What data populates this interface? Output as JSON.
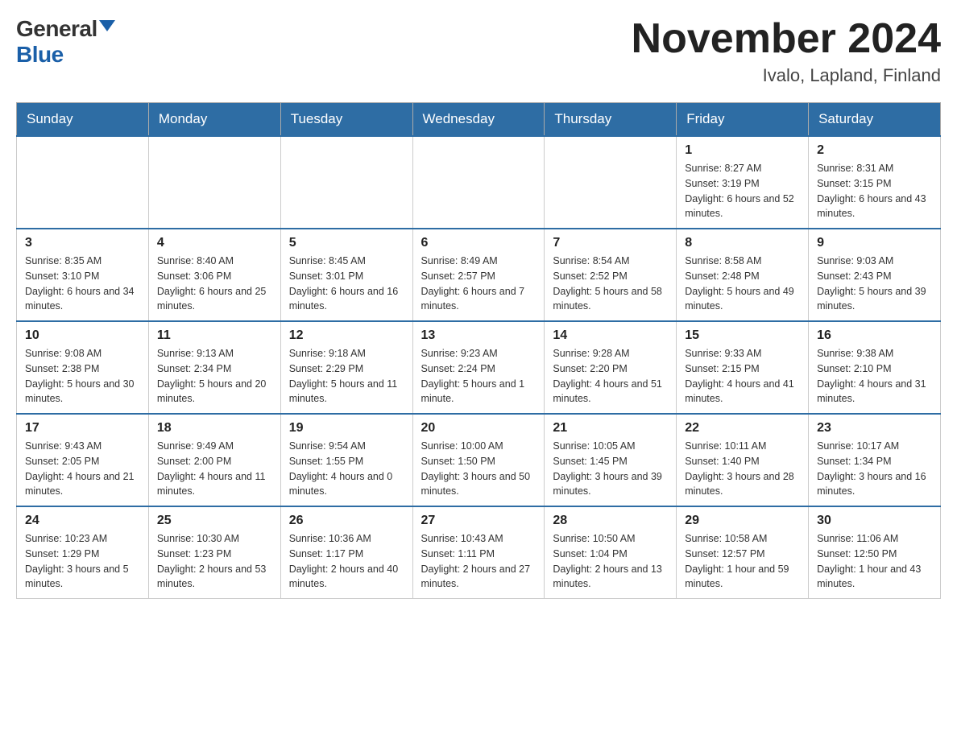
{
  "header": {
    "logo_general": "General",
    "logo_blue": "Blue",
    "month_year": "November 2024",
    "location": "Ivalo, Lapland, Finland"
  },
  "weekdays": [
    "Sunday",
    "Monday",
    "Tuesday",
    "Wednesday",
    "Thursday",
    "Friday",
    "Saturday"
  ],
  "weeks": [
    [
      {
        "day": "",
        "info": ""
      },
      {
        "day": "",
        "info": ""
      },
      {
        "day": "",
        "info": ""
      },
      {
        "day": "",
        "info": ""
      },
      {
        "day": "",
        "info": ""
      },
      {
        "day": "1",
        "info": "Sunrise: 8:27 AM\nSunset: 3:19 PM\nDaylight: 6 hours and 52 minutes."
      },
      {
        "day": "2",
        "info": "Sunrise: 8:31 AM\nSunset: 3:15 PM\nDaylight: 6 hours and 43 minutes."
      }
    ],
    [
      {
        "day": "3",
        "info": "Sunrise: 8:35 AM\nSunset: 3:10 PM\nDaylight: 6 hours and 34 minutes."
      },
      {
        "day": "4",
        "info": "Sunrise: 8:40 AM\nSunset: 3:06 PM\nDaylight: 6 hours and 25 minutes."
      },
      {
        "day": "5",
        "info": "Sunrise: 8:45 AM\nSunset: 3:01 PM\nDaylight: 6 hours and 16 minutes."
      },
      {
        "day": "6",
        "info": "Sunrise: 8:49 AM\nSunset: 2:57 PM\nDaylight: 6 hours and 7 minutes."
      },
      {
        "day": "7",
        "info": "Sunrise: 8:54 AM\nSunset: 2:52 PM\nDaylight: 5 hours and 58 minutes."
      },
      {
        "day": "8",
        "info": "Sunrise: 8:58 AM\nSunset: 2:48 PM\nDaylight: 5 hours and 49 minutes."
      },
      {
        "day": "9",
        "info": "Sunrise: 9:03 AM\nSunset: 2:43 PM\nDaylight: 5 hours and 39 minutes."
      }
    ],
    [
      {
        "day": "10",
        "info": "Sunrise: 9:08 AM\nSunset: 2:38 PM\nDaylight: 5 hours and 30 minutes."
      },
      {
        "day": "11",
        "info": "Sunrise: 9:13 AM\nSunset: 2:34 PM\nDaylight: 5 hours and 20 minutes."
      },
      {
        "day": "12",
        "info": "Sunrise: 9:18 AM\nSunset: 2:29 PM\nDaylight: 5 hours and 11 minutes."
      },
      {
        "day": "13",
        "info": "Sunrise: 9:23 AM\nSunset: 2:24 PM\nDaylight: 5 hours and 1 minute."
      },
      {
        "day": "14",
        "info": "Sunrise: 9:28 AM\nSunset: 2:20 PM\nDaylight: 4 hours and 51 minutes."
      },
      {
        "day": "15",
        "info": "Sunrise: 9:33 AM\nSunset: 2:15 PM\nDaylight: 4 hours and 41 minutes."
      },
      {
        "day": "16",
        "info": "Sunrise: 9:38 AM\nSunset: 2:10 PM\nDaylight: 4 hours and 31 minutes."
      }
    ],
    [
      {
        "day": "17",
        "info": "Sunrise: 9:43 AM\nSunset: 2:05 PM\nDaylight: 4 hours and 21 minutes."
      },
      {
        "day": "18",
        "info": "Sunrise: 9:49 AM\nSunset: 2:00 PM\nDaylight: 4 hours and 11 minutes."
      },
      {
        "day": "19",
        "info": "Sunrise: 9:54 AM\nSunset: 1:55 PM\nDaylight: 4 hours and 0 minutes."
      },
      {
        "day": "20",
        "info": "Sunrise: 10:00 AM\nSunset: 1:50 PM\nDaylight: 3 hours and 50 minutes."
      },
      {
        "day": "21",
        "info": "Sunrise: 10:05 AM\nSunset: 1:45 PM\nDaylight: 3 hours and 39 minutes."
      },
      {
        "day": "22",
        "info": "Sunrise: 10:11 AM\nSunset: 1:40 PM\nDaylight: 3 hours and 28 minutes."
      },
      {
        "day": "23",
        "info": "Sunrise: 10:17 AM\nSunset: 1:34 PM\nDaylight: 3 hours and 16 minutes."
      }
    ],
    [
      {
        "day": "24",
        "info": "Sunrise: 10:23 AM\nSunset: 1:29 PM\nDaylight: 3 hours and 5 minutes."
      },
      {
        "day": "25",
        "info": "Sunrise: 10:30 AM\nSunset: 1:23 PM\nDaylight: 2 hours and 53 minutes."
      },
      {
        "day": "26",
        "info": "Sunrise: 10:36 AM\nSunset: 1:17 PM\nDaylight: 2 hours and 40 minutes."
      },
      {
        "day": "27",
        "info": "Sunrise: 10:43 AM\nSunset: 1:11 PM\nDaylight: 2 hours and 27 minutes."
      },
      {
        "day": "28",
        "info": "Sunrise: 10:50 AM\nSunset: 1:04 PM\nDaylight: 2 hours and 13 minutes."
      },
      {
        "day": "29",
        "info": "Sunrise: 10:58 AM\nSunset: 12:57 PM\nDaylight: 1 hour and 59 minutes."
      },
      {
        "day": "30",
        "info": "Sunrise: 11:06 AM\nSunset: 12:50 PM\nDaylight: 1 hour and 43 minutes."
      }
    ]
  ]
}
